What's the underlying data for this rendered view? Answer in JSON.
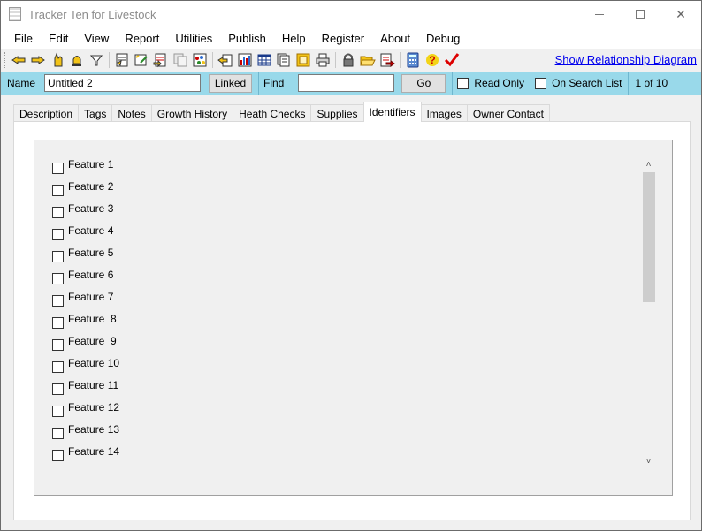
{
  "window": {
    "title": "Tracker Ten for Livestock"
  },
  "menu": [
    "File",
    "Edit",
    "View",
    "Report",
    "Utilities",
    "Publish",
    "Help",
    "Register",
    "About",
    "Debug"
  ],
  "toolbar": {
    "icons": [
      "pointer-left-icon",
      "pointer-right-icon",
      "hand-icon",
      "bell-icon",
      "filter-icon",
      "report-icon",
      "edit-record-icon",
      "import-icon",
      "copy-icon",
      "chart-icon",
      "pointer-doc-icon",
      "bar-chart-icon",
      "table-icon",
      "pages-icon",
      "frame-icon",
      "print-icon",
      "lock-icon",
      "folder-open-icon",
      "export-icon",
      "calculator-icon",
      "help-icon",
      "checkmark-icon"
    ],
    "relationship_link": "Show Relationship Diagram"
  },
  "search": {
    "name_label": "Name",
    "name_value": "Untitled 2",
    "linked_label": "Linked",
    "find_label": "Find",
    "find_value": "",
    "go_label": "Go",
    "read_only_label": "Read Only",
    "on_search_list_label": "On Search List",
    "record_position": "1 of 10"
  },
  "tabs": [
    {
      "label": "Description"
    },
    {
      "label": "Tags"
    },
    {
      "label": "Notes"
    },
    {
      "label": "Growth History"
    },
    {
      "label": "Heath Checks"
    },
    {
      "label": "Supplies"
    },
    {
      "label": "Identifiers",
      "active": true
    },
    {
      "label": "Images"
    },
    {
      "label": "Owner Contact"
    }
  ],
  "features": [
    "Feature 1",
    "Feature 2",
    "Feature 3",
    "Feature 4",
    "Feature 5",
    "Feature 6",
    "Feature 7",
    "Feature  8",
    "Feature  9",
    "Feature 10",
    "Feature 11",
    "Feature 12",
    "Feature 13",
    "Feature 14"
  ]
}
